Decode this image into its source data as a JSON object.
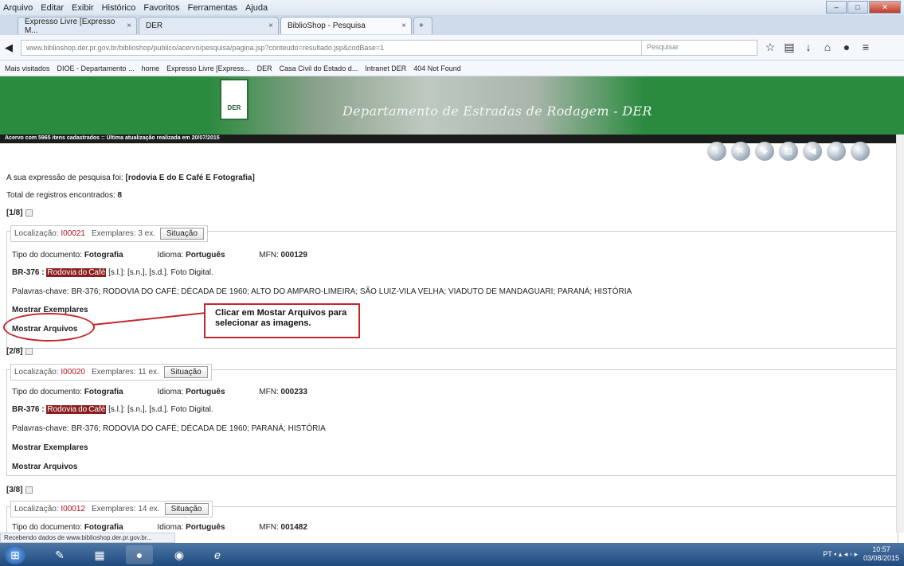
{
  "menu": [
    "Arquivo",
    "Editar",
    "Exibir",
    "Histórico",
    "Favoritos",
    "Ferramentas",
    "Ajuda"
  ],
  "tabs": [
    {
      "label": "Expresso Livre [Expresso M..."
    },
    {
      "label": "DER"
    },
    {
      "label": "BiblioShop - Pesquisa"
    }
  ],
  "address": {
    "url": "www.biblioshop.der.pr.gov.br/biblioshop/publico/acervo/pesquisa/pagina.jsp?conteudo=resultado.jsp&codBase=1",
    "search_placeholder": "Pesquisar"
  },
  "bookmarks": [
    "Mais visitados",
    "DIOE - Departamento ...",
    "home",
    "Expresso Livre [Express...",
    "DER",
    "Casa Civil do Estado d...",
    "Intranet DER",
    "404 Not Found"
  ],
  "banner": {
    "logo_text": "DER",
    "title": "Departamento de Estradas de Rodagem - DER",
    "info": "Acervo com 5965 itens cadastrados :: Última atualização realizada em 20/07/2015"
  },
  "search": {
    "expression_label": "A sua expressão de pesquisa foi:",
    "expression_value": "[rodovia E do E Café E Fotografia]",
    "total_label": "Total de registros encontrados:",
    "total_value": "8"
  },
  "records": [
    {
      "index": "[1/8]",
      "loc_label": "Localização:",
      "loc": "I00021",
      "ex_label": "Exemplares:",
      "ex": "3 ex.",
      "sit": "Situação",
      "tipo_label": "Tipo do documento:",
      "tipo": "Fotografia",
      "idioma_label": "Idioma:",
      "idioma": "Português",
      "mfn_label": "MFN:",
      "mfn": "000129",
      "title_prefix": "BR-376 :",
      "hl1": "Rodovia",
      "hl2": "do",
      "hl3": "Café",
      "title_rest": "[s.l.]: [s.n.], [s.d.]. Foto Digital.",
      "palavras_label": "Palavras-chave:",
      "palavras": "BR-376; RODOVIA DO CAFÉ; DÉCADA DE 1960; ALTO DO AMPARO-LIMEIRA; SÃO LUIZ-VILA VELHA; VIADUTO DE MANDAGUARI; PARANÁ; HISTÓRIA",
      "show_ex": "Mostrar Exemplares",
      "show_arq": "Mostrar Arquivos"
    },
    {
      "index": "[2/8]",
      "loc_label": "Localização:",
      "loc": "I00020",
      "ex_label": "Exemplares:",
      "ex": "11 ex.",
      "sit": "Situação",
      "tipo_label": "Tipo do documento:",
      "tipo": "Fotografia",
      "idioma_label": "Idioma:",
      "idioma": "Português",
      "mfn_label": "MFN:",
      "mfn": "000233",
      "title_prefix": "BR-376 :",
      "hl1": "Rodovia",
      "hl2": "do",
      "hl3": "Café",
      "title_rest": "[s.l.]: [s.n.], [s.d.]. Foto Digital.",
      "palavras_label": "Palavras-chave:",
      "palavras": "BR-376; RODOVIA DO CAFÉ; DÉCADA DE 1960; PARANÁ; HISTÓRIA",
      "show_ex": "Mostrar Exemplares",
      "show_arq": "Mostrar Arquivos"
    },
    {
      "index": "[3/8]",
      "loc_label": "Localização:",
      "loc": "I00012",
      "ex_label": "Exemplares:",
      "ex": "14 ex.",
      "sit": "Situação",
      "tipo_label": "Tipo do documento:",
      "tipo": "Fotografia",
      "idioma_label": "Idioma:",
      "idioma": "Português",
      "mfn_label": "MFN:",
      "mfn": "001482"
    }
  ],
  "callout": "Clicar em Mostar Arquivos para selecionar as imagens.",
  "status": "Recebendo dados de www.biblioshop.der.pr.gov.br...",
  "taskbar": {
    "lang": "PT",
    "time": "10:57",
    "date": "03/08/2015"
  }
}
